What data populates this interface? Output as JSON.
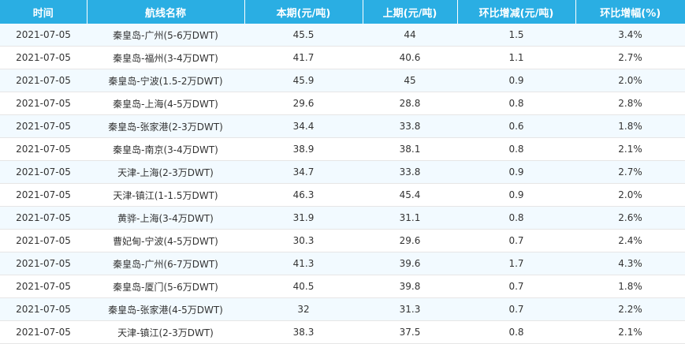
{
  "table": {
    "headers": [
      "时间",
      "航线名称",
      "本期(元/吨)",
      "上期(元/吨)",
      "环比增减(元/吨)",
      "环比增幅(%)"
    ],
    "rows": [
      [
        "2021-07-05",
        "秦皇岛-广州(5-6万DWT)",
        "45.5",
        "44",
        "1.5",
        "3.4%"
      ],
      [
        "2021-07-05",
        "秦皇岛-福州(3-4万DWT)",
        "41.7",
        "40.6",
        "1.1",
        "2.7%"
      ],
      [
        "2021-07-05",
        "秦皇岛-宁波(1.5-2万DWT)",
        "45.9",
        "45",
        "0.9",
        "2.0%"
      ],
      [
        "2021-07-05",
        "秦皇岛-上海(4-5万DWT)",
        "29.6",
        "28.8",
        "0.8",
        "2.8%"
      ],
      [
        "2021-07-05",
        "秦皇岛-张家港(2-3万DWT)",
        "34.4",
        "33.8",
        "0.6",
        "1.8%"
      ],
      [
        "2021-07-05",
        "秦皇岛-南京(3-4万DWT)",
        "38.9",
        "38.1",
        "0.8",
        "2.1%"
      ],
      [
        "2021-07-05",
        "天津-上海(2-3万DWT)",
        "34.7",
        "33.8",
        "0.9",
        "2.7%"
      ],
      [
        "2021-07-05",
        "天津-镇江(1-1.5万DWT)",
        "46.3",
        "45.4",
        "0.9",
        "2.0%"
      ],
      [
        "2021-07-05",
        "黄骅-上海(3-4万DWT)",
        "31.9",
        "31.1",
        "0.8",
        "2.6%"
      ],
      [
        "2021-07-05",
        "曹妃甸-宁波(4-5万DWT)",
        "30.3",
        "29.6",
        "0.7",
        "2.4%"
      ],
      [
        "2021-07-05",
        "秦皇岛-广州(6-7万DWT)",
        "41.3",
        "39.6",
        "1.7",
        "4.3%"
      ],
      [
        "2021-07-05",
        "秦皇岛-厦门(5-6万DWT)",
        "40.5",
        "39.8",
        "0.7",
        "1.8%"
      ],
      [
        "2021-07-05",
        "秦皇岛-张家港(4-5万DWT)",
        "32",
        "31.3",
        "0.7",
        "2.2%"
      ],
      [
        "2021-07-05",
        "天津-镇江(2-3万DWT)",
        "38.3",
        "37.5",
        "0.8",
        "2.1%"
      ]
    ]
  },
  "colors": {
    "header_bg": "#2aaee3",
    "header_text": "#ffffff",
    "row_alt_bg": "#f2faff",
    "text": "#333333"
  }
}
